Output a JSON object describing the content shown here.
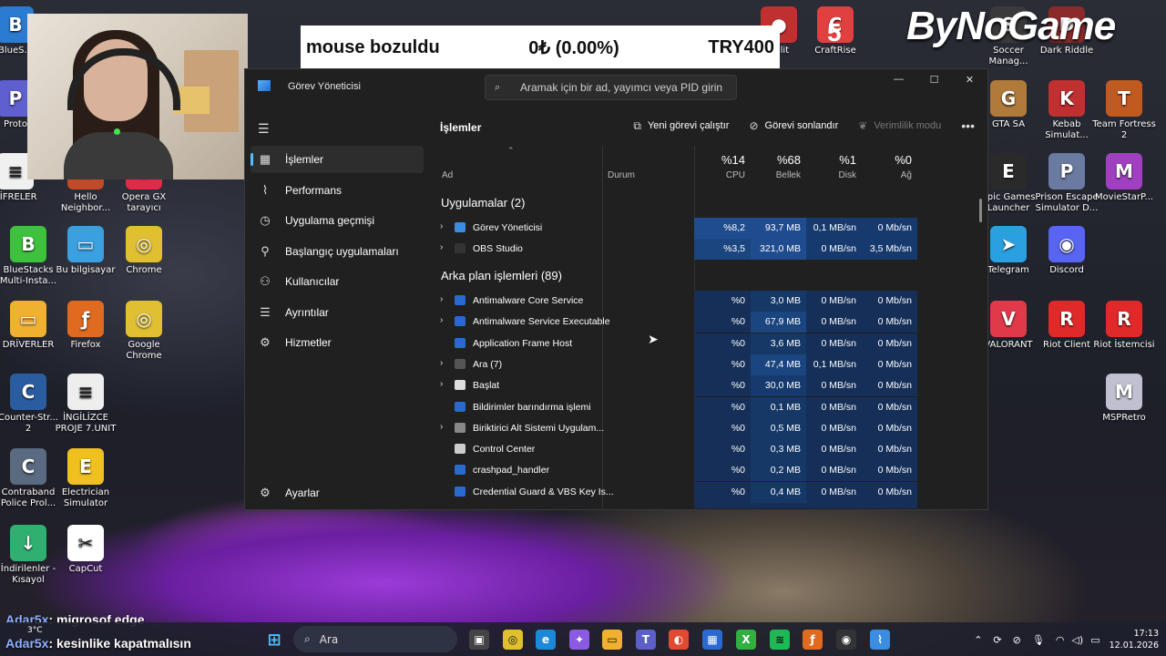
{
  "banner": {
    "text": "mouse bozuldu",
    "amount": "0₺ (0.00%)",
    "goal": "TRY400"
  },
  "overlay": {
    "brand": "ByNoGame",
    "count": "5"
  },
  "desktop_icons": [
    {
      "label": "BlueS...",
      "color": "#2a7bd1",
      "glyph": "B"
    },
    {
      "label": "Proto",
      "color": "#5f5fd0",
      "glyph": "P"
    },
    {
      "label": "ŞİFRELER",
      "color": "#f0f0f0",
      "glyph": "≡"
    },
    {
      "label": "Hello Neighbor...",
      "color": "#c04a2a",
      "glyph": "H"
    },
    {
      "label": "Opera GX tarayıcı",
      "color": "#e02a4a",
      "glyph": "O"
    },
    {
      "label": "BlueStacks Multi-Insta...",
      "color": "#3ec23e",
      "glyph": "B"
    },
    {
      "label": "Bu bilgisayar",
      "color": "#3aa0e0",
      "glyph": "▭"
    },
    {
      "label": "Chrome",
      "color": "#e0c030",
      "glyph": "◎"
    },
    {
      "label": "DRİVERLER",
      "color": "#f0b030",
      "glyph": "▭"
    },
    {
      "label": "Firefox",
      "color": "#e06a20",
      "glyph": "ƒ"
    },
    {
      "label": "Google Chrome",
      "color": "#e0c030",
      "glyph": "◎"
    },
    {
      "label": "Counter-Str... 2",
      "color": "#2a5da0",
      "glyph": "C"
    },
    {
      "label": "İNGİLİZCE PROJE 7.UNIT",
      "color": "#eeeeee",
      "glyph": "≡"
    },
    {
      "label": "Contraband Police Prol...",
      "color": "#5a6a80",
      "glyph": "C"
    },
    {
      "label": "Electrician Simulator",
      "color": "#f0c020",
      "glyph": "E"
    },
    {
      "label": "İndirilenler - Kısayol",
      "color": "#2fb070",
      "glyph": "↓"
    },
    {
      "label": "CapCut",
      "color": "#ffffff",
      "glyph": "✂"
    },
    {
      "label": "Soccer Manag...",
      "color": "#3a3a3a",
      "glyph": "S"
    },
    {
      "label": "Dark Riddle",
      "color": "#8a2a2a",
      "glyph": "D"
    },
    {
      "label": "GTA SA",
      "color": "#b07a3a",
      "glyph": "G"
    },
    {
      "label": "Kebab Simulat...",
      "color": "#c03030",
      "glyph": "K"
    },
    {
      "label": "Team Fortress 2",
      "color": "#c05a20",
      "glyph": "T"
    },
    {
      "label": "Epic Games Launcher",
      "color": "#2a2a2a",
      "glyph": "E"
    },
    {
      "label": "Prison Escape Simulator D...",
      "color": "#6a7aa0",
      "glyph": "P"
    },
    {
      "label": "MovieStarP...",
      "color": "#a040c0",
      "glyph": "M"
    },
    {
      "label": "Telegram",
      "color": "#2aa0e0",
      "glyph": "➤"
    },
    {
      "label": "Discord",
      "color": "#5865f2",
      "glyph": "◉"
    },
    {
      "label": "VALORANT",
      "color": "#e03a4a",
      "glyph": "V"
    },
    {
      "label": "Riot Client",
      "color": "#e02a2a",
      "glyph": "R"
    },
    {
      "label": "Riot İstemcisi",
      "color": "#e02a2a",
      "glyph": "R"
    },
    {
      "label": "MSPRetro",
      "color": "#c0c0d0",
      "glyph": "M"
    },
    {
      "label": "Split",
      "color": "#c03030",
      "glyph": "●"
    },
    {
      "label": "CraftRise",
      "color": "#e04040",
      "glyph": "C"
    }
  ],
  "window": {
    "title": "Görev Yöneticisi",
    "search_placeholder": "Aramak için bir ad, yayımcı veya PID girin",
    "controls": [
      "—",
      "☐",
      "✕"
    ]
  },
  "nav": {
    "items": [
      {
        "icon": "processes-icon",
        "glyph": "▦",
        "label": "İşlemler",
        "active": true
      },
      {
        "icon": "performance-icon",
        "glyph": "⌇",
        "label": "Performans",
        "active": false
      },
      {
        "icon": "app-history-icon",
        "glyph": "◷",
        "label": "Uygulama geçmişi",
        "active": false
      },
      {
        "icon": "startup-icon",
        "glyph": "⚲",
        "label": "Başlangıç uygulamaları",
        "active": false
      },
      {
        "icon": "users-icon",
        "glyph": "⚇",
        "label": "Kullanıcılar",
        "active": false
      },
      {
        "icon": "details-icon",
        "glyph": "☰",
        "label": "Ayrıntılar",
        "active": false
      },
      {
        "icon": "services-icon",
        "glyph": "⚙",
        "label": "Hizmetler",
        "active": false
      }
    ],
    "settings": "Ayarlar"
  },
  "page": {
    "title": "İşlemler",
    "toolbar": {
      "new_task": "Yeni görevi çalıştır",
      "end_task": "Görevi sonlandır",
      "efficiency": "Verimlilik modu"
    }
  },
  "table": {
    "columns": {
      "name": "Ad",
      "status": "Durum",
      "cpu": {
        "pct": "%14",
        "label": "CPU"
      },
      "mem": {
        "pct": "%68",
        "label": "Bellek"
      },
      "disk": {
        "pct": "%1",
        "label": "Disk"
      },
      "net": {
        "pct": "%0",
        "label": "Ağ"
      }
    },
    "apps_group": "Uygulamalar (2)",
    "apps": [
      {
        "name": "Görev Yöneticisi",
        "expand": true,
        "icon": "#3a8de0",
        "cpu": "%8,2",
        "mem": "93,7 MB",
        "disk": "0,1 MB/sn",
        "net": "0 Mb/sn",
        "cpu_hl": "#1f4c8f",
        "mem_hl": "#1f4c8f",
        "disk_hl": "#173a6e",
        "net_hl": "#173a6e"
      },
      {
        "name": "OBS Studio",
        "expand": true,
        "icon": "#333333",
        "cpu": "%3,5",
        "mem": "321,0 MB",
        "disk": "0 MB/sn",
        "net": "3,5 Mb/sn",
        "cpu_hl": "#1b457f",
        "mem_hl": "#1f4c8f",
        "disk_hl": "#173a6e",
        "net_hl": "#173a6e"
      }
    ],
    "bg_group": "Arka plan işlemleri (89)",
    "bg": [
      {
        "name": "Antimalware Core Service",
        "expand": true,
        "icon": "#2a6ad0",
        "cpu": "%0",
        "mem": "3,0 MB",
        "disk": "0 MB/sn",
        "net": "0 Mb/sn",
        "mem_hl": "#163866"
      },
      {
        "name": "Antimalware Service Executable",
        "expand": true,
        "icon": "#2a6ad0",
        "cpu": "%0",
        "mem": "67,9 MB",
        "disk": "0 MB/sn",
        "net": "0 Mb/sn",
        "mem_hl": "#1b457f"
      },
      {
        "name": "Application Frame Host",
        "expand": false,
        "icon": "#2a6ad0",
        "cpu": "%0",
        "mem": "3,6 MB",
        "disk": "0 MB/sn",
        "net": "0 Mb/sn",
        "mem_hl": "#163866"
      },
      {
        "name": "Ara (7)",
        "expand": true,
        "icon": "#555555",
        "cpu": "%0",
        "mem": "47,4 MB",
        "disk": "0,1 MB/sn",
        "net": "0 Mb/sn",
        "mem_hl": "#1b457f"
      },
      {
        "name": "Başlat",
        "expand": true,
        "icon": "#dddddd",
        "cpu": "%0",
        "mem": "30,0 MB",
        "disk": "0 MB/sn",
        "net": "0 Mb/sn",
        "mem_hl": "#173a6e"
      },
      {
        "name": "Bildirimler barındırma işlemi",
        "expand": false,
        "icon": "#2a6ad0",
        "cpu": "%0",
        "mem": "0,1 MB",
        "disk": "0 MB/sn",
        "net": "0 Mb/sn",
        "mem_hl": "#163866"
      },
      {
        "name": "Biriktirici Alt Sistemi Uygulam...",
        "expand": true,
        "icon": "#888888",
        "cpu": "%0",
        "mem": "0,5 MB",
        "disk": "0 MB/sn",
        "net": "0 Mb/sn",
        "mem_hl": "#163866"
      },
      {
        "name": "Control Center",
        "expand": false,
        "icon": "#cccccc",
        "cpu": "%0",
        "mem": "0,3 MB",
        "disk": "0 MB/sn",
        "net": "0 Mb/sn",
        "mem_hl": "#163866"
      },
      {
        "name": "crashpad_handler",
        "expand": false,
        "icon": "#2a6ad0",
        "cpu": "%0",
        "mem": "0,2 MB",
        "disk": "0 MB/sn",
        "net": "0 Mb/sn",
        "mem_hl": "#163866"
      },
      {
        "name": "Credential Guard & VBS Key Is...",
        "expand": false,
        "icon": "#2a6ad0",
        "cpu": "%0",
        "mem": "0,4 MB",
        "disk": "0 MB/sn",
        "net": "0 Mb/sn",
        "mem_hl": "#163866"
      }
    ]
  },
  "chat": [
    {
      "user": "Adar5x",
      "message": ": migrosof edge"
    },
    {
      "user": "Adar5x",
      "message": ": kesinlike kapatmalısın"
    }
  ],
  "taskbar": {
    "search": "Ara",
    "weather": "3°C",
    "time": "17:13",
    "date": "12.01.2026"
  }
}
